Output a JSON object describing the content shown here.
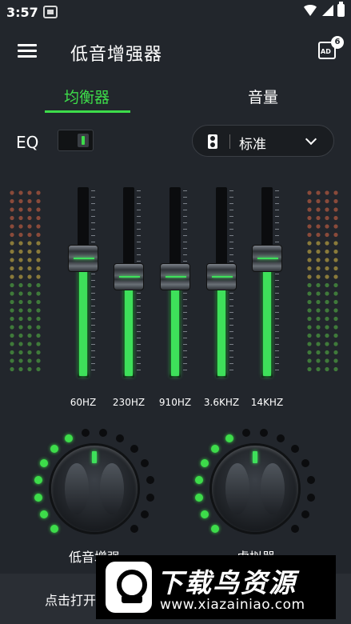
{
  "status_bar": {
    "time": "3:57"
  },
  "app_bar": {
    "title": "低音增强器",
    "ad_text": "AD",
    "ad_badge": "6"
  },
  "tabs": [
    {
      "label": "均衡器",
      "active": true
    },
    {
      "label": "音量",
      "active": false
    }
  ],
  "eq": {
    "label": "EQ",
    "enabled": true,
    "preset": "标准"
  },
  "bands": [
    {
      "label": "60HZ",
      "level": 0.62
    },
    {
      "label": "230HZ",
      "level": 0.52
    },
    {
      "label": "910HZ",
      "level": 0.52
    },
    {
      "label": "3.6KHZ",
      "level": 0.52
    },
    {
      "label": "14KHZ",
      "level": 0.62
    }
  ],
  "knobs": [
    {
      "label": "低音增强",
      "active_fraction": 0.45
    },
    {
      "label": "虚拟器",
      "active_fraction": 0.45
    }
  ],
  "bottom": {
    "hint": "点击打开"
  },
  "watermark": {
    "title": "下载鸟资源",
    "url": "www.xiazainiao.com"
  },
  "colors": {
    "accent": "#3ddc4a",
    "background": "#22262c",
    "inactive_dot": "#0b0c0e"
  }
}
